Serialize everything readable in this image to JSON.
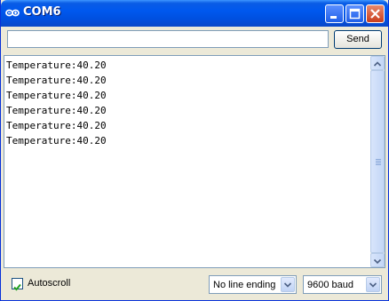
{
  "window": {
    "title": "COM6",
    "accent": "#0058ee",
    "close_color": "#c93d1c"
  },
  "send": {
    "input_value": "",
    "button_label": "Send"
  },
  "output": {
    "lines": [
      "Temperature:40.20",
      "Temperature:40.20",
      "Temperature:40.20",
      "Temperature:40.20",
      "Temperature:40.20",
      "Temperature:40.20"
    ]
  },
  "footer": {
    "autoscroll_label": "Autoscroll",
    "autoscroll_checked": true,
    "line_ending": "No line ending",
    "baud_rate": "9600 baud"
  },
  "icons": [
    "arduino-logo-icon",
    "minimize-icon",
    "maximize-icon",
    "close-icon",
    "scroll-up-icon",
    "scroll-down-icon",
    "checkmark-icon",
    "dropdown-arrow-icon"
  ]
}
